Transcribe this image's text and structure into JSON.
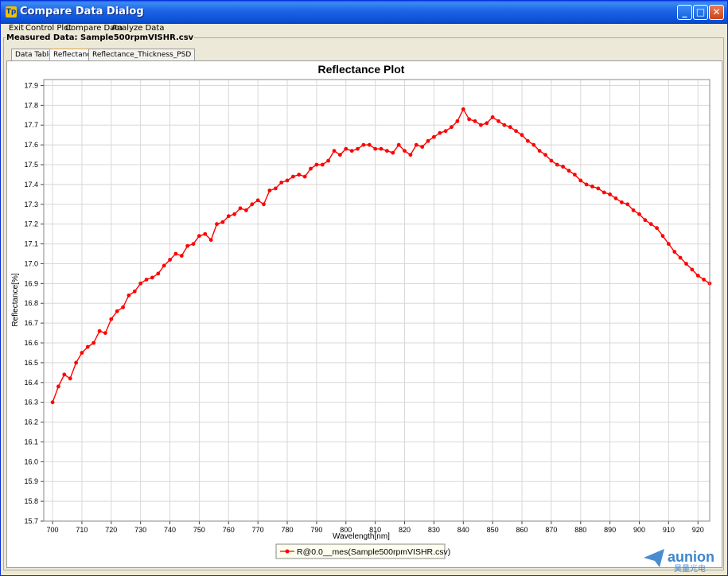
{
  "window": {
    "title": "Compare Data Dialog",
    "icon_text": "Tp",
    "controls": {
      "minimize": "_",
      "maximize": "□",
      "close": "✕"
    }
  },
  "menu": [
    {
      "label": "Exit"
    },
    {
      "label": "Control Plot"
    },
    {
      "label": "Compare Data"
    },
    {
      "label": "Analyze Data"
    }
  ],
  "group": {
    "label": "Measured Data: Sample500rpmVISHR.csv"
  },
  "tabs": [
    {
      "label": "Data Table",
      "active": false
    },
    {
      "label": "Reflectance",
      "active": true
    },
    {
      "label": "Reflectance_Thickness_PSD",
      "active": false
    }
  ],
  "watermark": {
    "text": "aunion",
    "subtext": "昊量光电"
  },
  "colors": {
    "series": "#ff0000",
    "grid": "#d8d8d8",
    "accent": "#0a5fe3"
  },
  "chart_data": {
    "type": "line",
    "title": "Reflectance Plot",
    "xlabel": "Wavelength[nm]",
    "ylabel": "Reflectance[%]",
    "xlim": [
      697,
      924
    ],
    "ylim": [
      15.7,
      17.93
    ],
    "xticks": [
      700,
      710,
      720,
      730,
      740,
      750,
      760,
      770,
      780,
      790,
      800,
      810,
      820,
      830,
      840,
      850,
      860,
      870,
      880,
      890,
      900,
      910,
      920
    ],
    "yticks": [
      "15.7",
      "15.8",
      "15.9",
      "16.0",
      "16.1",
      "16.2",
      "16.3",
      "16.4",
      "16.5",
      "16.6",
      "16.7",
      "16.8",
      "16.9",
      "17.0",
      "17.1",
      "17.2",
      "17.3",
      "17.4",
      "17.5",
      "17.6",
      "17.7",
      "17.8",
      "17.9"
    ],
    "grid": true,
    "legend_position": "bottom-center",
    "series": [
      {
        "name": "R@0.0__mes(Sample500rpmVISHR.csv)",
        "x": [
          700,
          702,
          704,
          706,
          708,
          710,
          712,
          714,
          716,
          718,
          720,
          722,
          724,
          726,
          728,
          730,
          732,
          734,
          736,
          738,
          740,
          742,
          744,
          746,
          748,
          750,
          752,
          754,
          756,
          758,
          760,
          762,
          764,
          766,
          768,
          770,
          772,
          774,
          776,
          778,
          780,
          782,
          784,
          786,
          788,
          790,
          792,
          794,
          796,
          798,
          800,
          802,
          804,
          806,
          808,
          810,
          812,
          814,
          816,
          818,
          820,
          822,
          824,
          826,
          828,
          830,
          832,
          834,
          836,
          838,
          840,
          842,
          844,
          846,
          848,
          850,
          852,
          854,
          856,
          858,
          860,
          862,
          864,
          866,
          868,
          870,
          872,
          874,
          876,
          878,
          880,
          882,
          884,
          886,
          888,
          890,
          892,
          894,
          896,
          898,
          900,
          902,
          904,
          906,
          908,
          910,
          912,
          914,
          916,
          918,
          920,
          922,
          924
        ],
        "y": [
          16.3,
          16.38,
          16.44,
          16.42,
          16.5,
          16.55,
          16.58,
          16.6,
          16.66,
          16.65,
          16.72,
          16.76,
          16.78,
          16.84,
          16.86,
          16.9,
          16.92,
          16.93,
          16.95,
          16.99,
          17.02,
          17.05,
          17.04,
          17.09,
          17.1,
          17.14,
          17.15,
          17.12,
          17.2,
          17.21,
          17.24,
          17.25,
          17.28,
          17.27,
          17.3,
          17.32,
          17.3,
          17.37,
          17.38,
          17.41,
          17.42,
          17.44,
          17.45,
          17.44,
          17.48,
          17.5,
          17.5,
          17.52,
          17.57,
          17.55,
          17.58,
          17.57,
          17.58,
          17.6,
          17.6,
          17.58,
          17.58,
          17.57,
          17.56,
          17.6,
          17.57,
          17.55,
          17.6,
          17.59,
          17.62,
          17.64,
          17.66,
          17.67,
          17.69,
          17.72,
          17.78,
          17.73,
          17.72,
          17.7,
          17.71,
          17.74,
          17.72,
          17.7,
          17.69,
          17.67,
          17.65,
          17.62,
          17.6,
          17.57,
          17.55,
          17.52,
          17.5,
          17.49,
          17.47,
          17.45,
          17.42,
          17.4,
          17.39,
          17.38,
          17.36,
          17.35,
          17.33,
          17.31,
          17.3,
          17.27,
          17.25,
          17.22,
          17.2,
          17.18,
          17.14,
          17.1,
          17.06,
          17.03,
          17.0,
          16.97,
          16.94,
          16.92,
          16.9
        ]
      }
    ]
  }
}
